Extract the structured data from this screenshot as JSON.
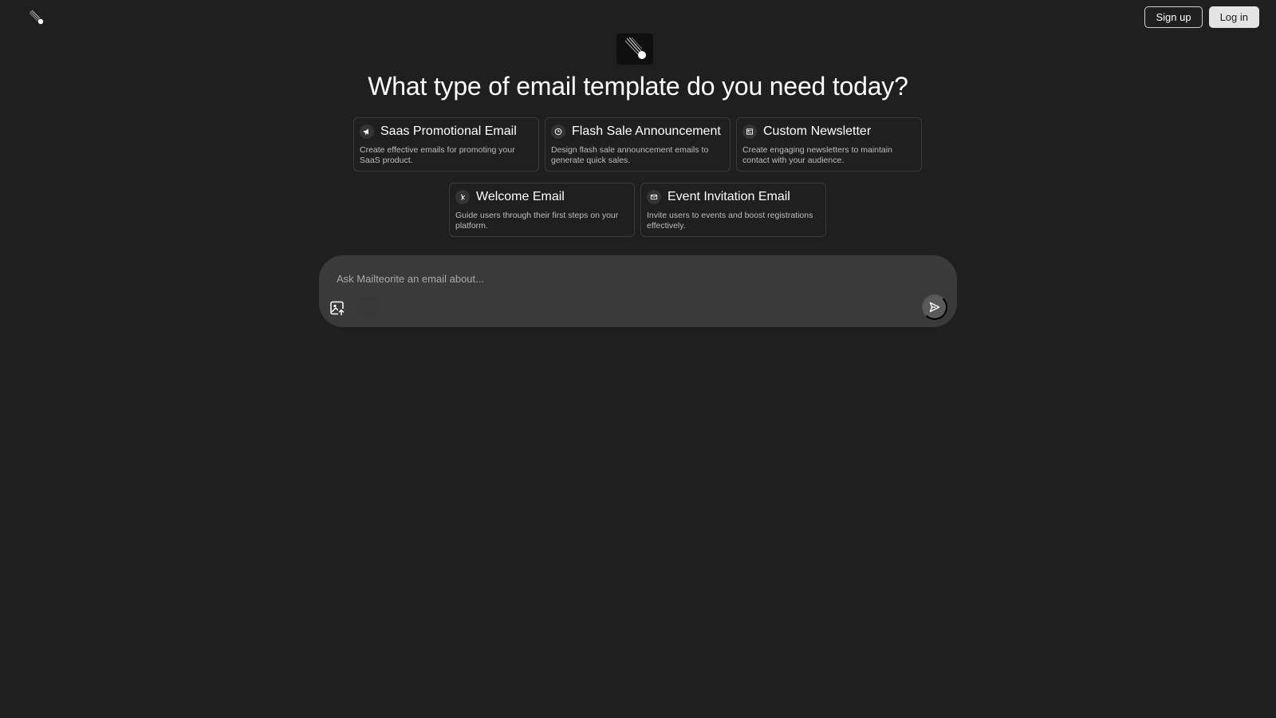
{
  "header": {
    "signup_label": "Sign up",
    "login_label": "Log in",
    "logo_icon": "meteor-icon"
  },
  "main": {
    "title": "What type of email template do you need today?",
    "cards": [
      {
        "icon": "megaphone-icon",
        "title": "Saas Promotional Email",
        "description": "Create effective emails for promoting your SaaS product."
      },
      {
        "icon": "clock-icon",
        "title": "Flash Sale Announcement",
        "description": "Design flash sale announcement emails to generate quick sales."
      },
      {
        "icon": "newspaper-icon",
        "title": "Custom Newsletter",
        "description": "Create engaging newsletters to maintain contact with your audience."
      },
      {
        "icon": "hand-wave-icon",
        "title": "Welcome Email",
        "description": "Guide users through their first steps on your platform."
      },
      {
        "icon": "mail-icon",
        "title": "Event Invitation Email",
        "description": "Invite users to events and boost registrations effectively."
      }
    ]
  },
  "composer": {
    "placeholder": "Ask Mailteorite an email about...",
    "value": "",
    "upload_icon": "image-upload-icon",
    "send_icon": "send-icon"
  },
  "colors": {
    "background": "#1f1f1f",
    "composer": "#3a3a3a",
    "card_border": "#3a3a3a",
    "send_button": "#5a5a5a"
  }
}
